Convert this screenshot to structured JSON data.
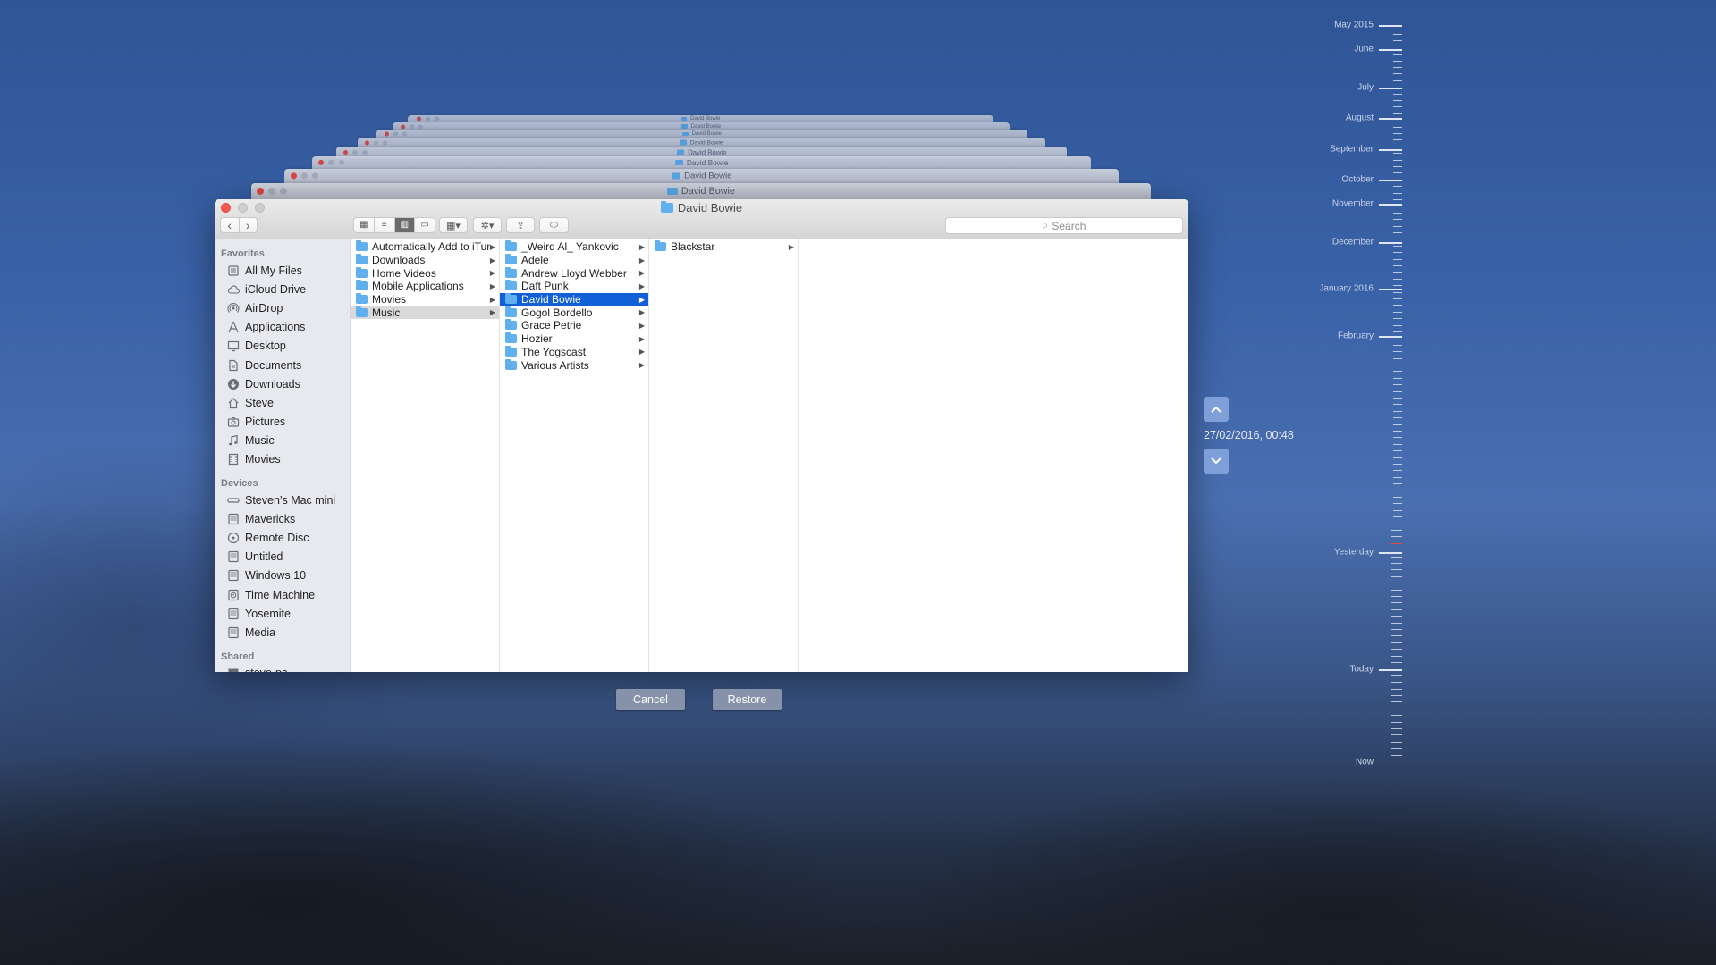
{
  "window": {
    "title": "David Bowie",
    "history_title": "David Bowie"
  },
  "toolbar": {
    "back_icon": "chevron-left-icon",
    "forward_icon": "chevron-right-icon",
    "search_placeholder": "Search"
  },
  "sidebar": {
    "favorites_header": "Favorites",
    "favorites": [
      {
        "label": "All My Files",
        "icon": "all-files-icon"
      },
      {
        "label": "iCloud Drive",
        "icon": "cloud-icon"
      },
      {
        "label": "AirDrop",
        "icon": "airdrop-icon"
      },
      {
        "label": "Applications",
        "icon": "applications-icon"
      },
      {
        "label": "Desktop",
        "icon": "desktop-icon"
      },
      {
        "label": "Documents",
        "icon": "documents-icon"
      },
      {
        "label": "Downloads",
        "icon": "downloads-icon"
      },
      {
        "label": "Steve",
        "icon": "home-icon"
      },
      {
        "label": "Pictures",
        "icon": "camera-icon"
      },
      {
        "label": "Music",
        "icon": "music-note-icon"
      },
      {
        "label": "Movies",
        "icon": "film-icon"
      }
    ],
    "devices_header": "Devices",
    "devices": [
      {
        "label": "Steven’s Mac mini",
        "icon": "mac-mini-icon"
      },
      {
        "label": "Mavericks",
        "icon": "disk-icon"
      },
      {
        "label": "Remote Disc",
        "icon": "disc-icon"
      },
      {
        "label": "Untitled",
        "icon": "disk-icon"
      },
      {
        "label": "Windows 10",
        "icon": "disk-icon"
      },
      {
        "label": "Time Machine",
        "icon": "time-machine-icon"
      },
      {
        "label": "Yosemite",
        "icon": "disk-icon"
      },
      {
        "label": "Media",
        "icon": "disk-icon"
      }
    ],
    "shared_header": "Shared",
    "shared": [
      {
        "label": "steve-pc",
        "icon": "pc-icon"
      }
    ]
  },
  "columns": {
    "col1": [
      {
        "label": "Automatically Add to iTunes",
        "state": ""
      },
      {
        "label": "Downloads",
        "state": ""
      },
      {
        "label": "Home Videos",
        "state": ""
      },
      {
        "label": "Mobile Applications",
        "state": ""
      },
      {
        "label": "Movies",
        "state": ""
      },
      {
        "label": "Music",
        "state": "sel-grey"
      }
    ],
    "col2": [
      {
        "label": "_Weird Al_ Yankovic",
        "state": ""
      },
      {
        "label": "Adele",
        "state": ""
      },
      {
        "label": "Andrew Lloyd Webber",
        "state": ""
      },
      {
        "label": "Daft Punk",
        "state": ""
      },
      {
        "label": "David Bowie",
        "state": "sel-blue"
      },
      {
        "label": "Gogol Bordello",
        "state": ""
      },
      {
        "label": "Grace Petrie",
        "state": ""
      },
      {
        "label": "Hozier",
        "state": ""
      },
      {
        "label": "The Yogscast",
        "state": ""
      },
      {
        "label": "Various Artists",
        "state": ""
      }
    ],
    "col3": [
      {
        "label": "Blackstar",
        "state": ""
      }
    ]
  },
  "buttons": {
    "cancel": "Cancel",
    "restore": "Restore"
  },
  "time_nav": {
    "up_icon": "chevron-up-icon",
    "down_icon": "chevron-down-icon",
    "current": "27/02/2016, 00:48"
  },
  "timeline": {
    "labels": [
      "May 2015",
      "June",
      "July",
      "August",
      "September",
      "October",
      "November",
      "December",
      "January 2016",
      "February",
      "Yesterday",
      "Today",
      "Now"
    ]
  },
  "colors": {
    "selection_blue": "#1160d8",
    "close_red": "#fc5753",
    "folder_blue": "#5fb0ed"
  }
}
